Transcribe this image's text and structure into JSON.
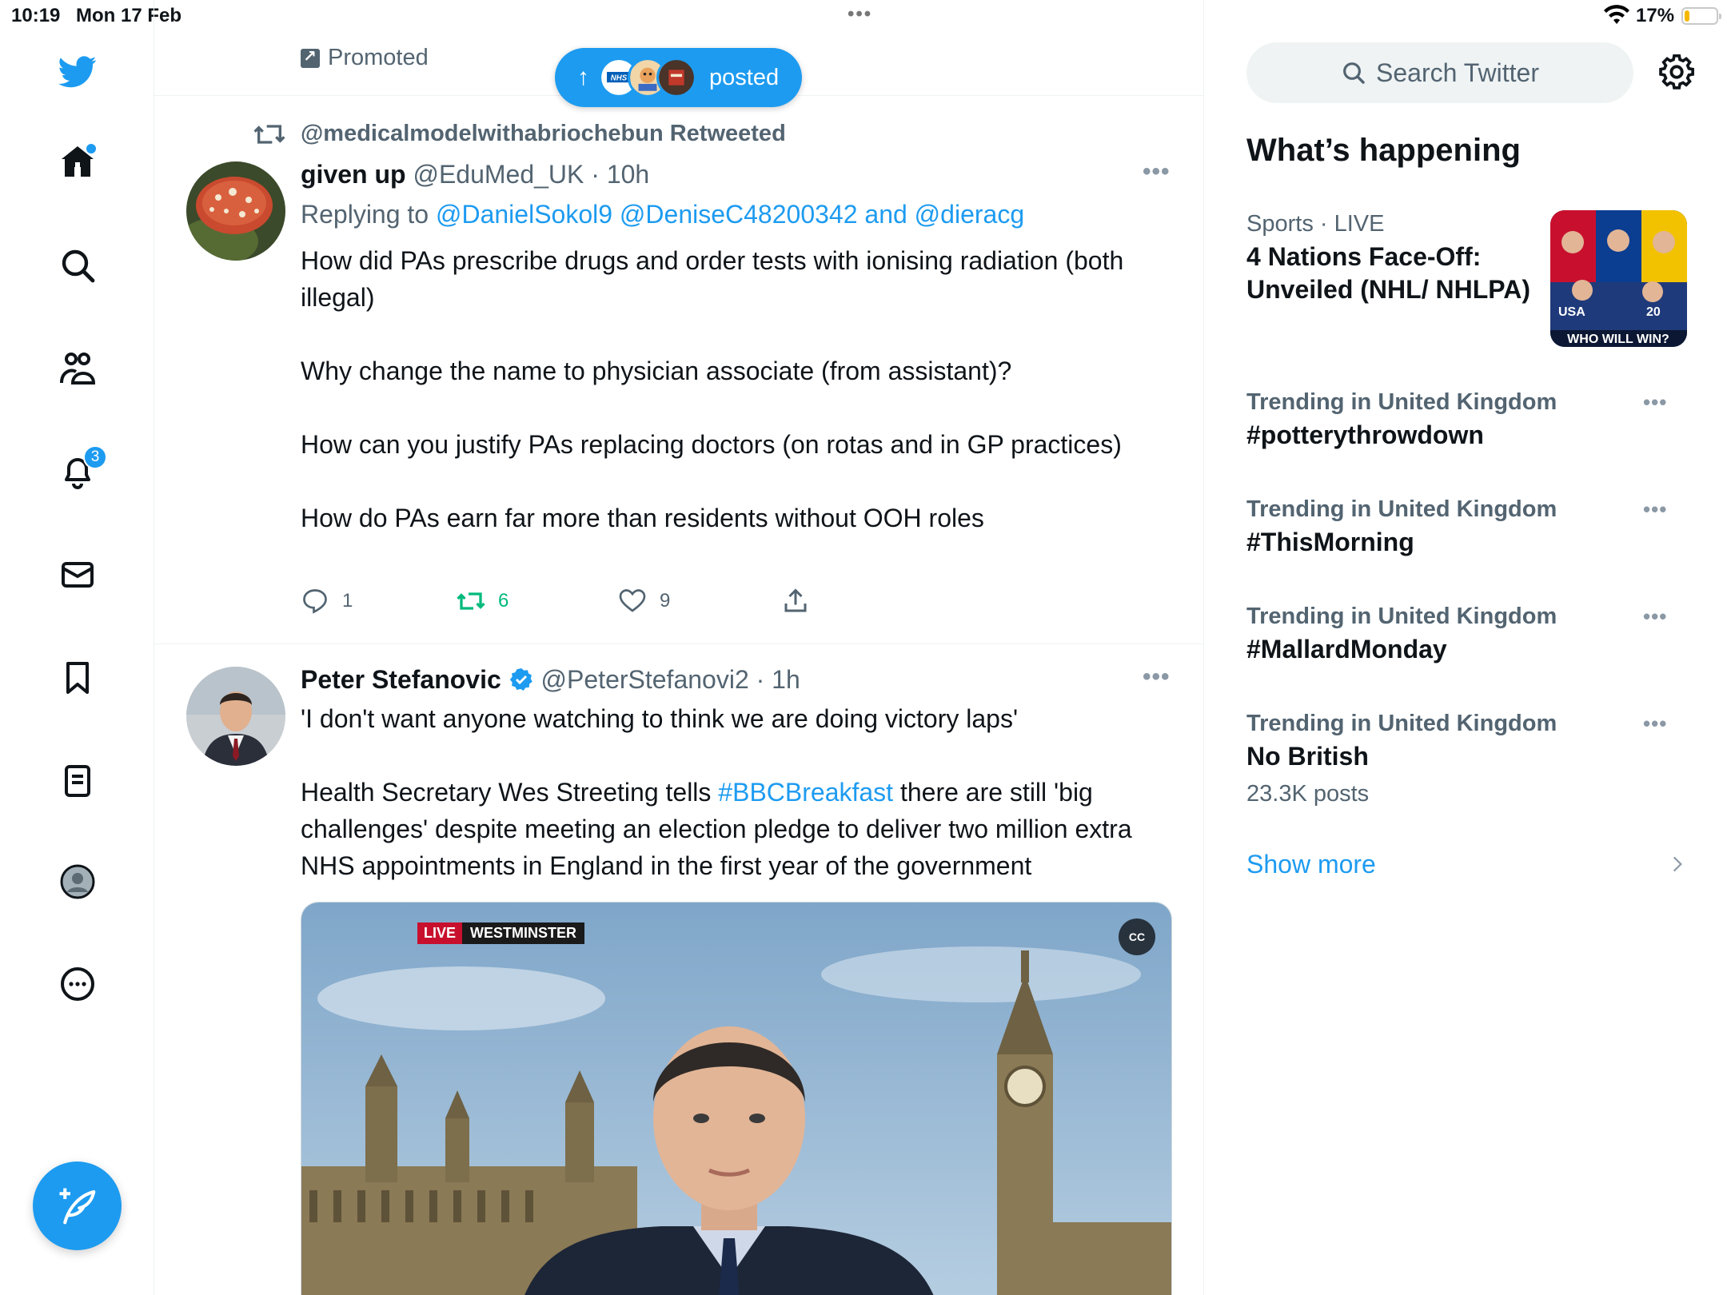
{
  "status": {
    "time": "10:19",
    "date": "Mon 17 Feb",
    "multitask": "•••",
    "battery_pct": "17%",
    "battery_level": 0.17
  },
  "nav": {
    "notifications_badge": "3"
  },
  "timeline": {
    "promoted_label": "Promoted",
    "new_posts_label": "posted"
  },
  "tweet1": {
    "retweeted_by": "@medicalmodelwithabriochebun Retweeted",
    "name": "given up",
    "handle": "@EduMed_UK",
    "sep": " · ",
    "time": "10h",
    "replying_to_prefix": "Replying to",
    "mention1": "@DanielSokol9",
    "mention2": "@DeniseC48200342",
    "and": "and",
    "mention3": "@dieracg",
    "para1": "How did PAs prescribe drugs and order tests with ionising radiation (both illegal)",
    "para2": "Why change the name to physician associate (from assistant)?",
    "para3": "How can you justify PAs replacing doctors (on rotas and in GP practices)",
    "para4": "How do PAs earn far more than residents without OOH roles",
    "replies": "1",
    "retweets": "6",
    "likes": "9"
  },
  "tweet2": {
    "name": "Peter Stefanovic",
    "handle": "@PeterStefanovi2",
    "sep": " · ",
    "time": "1h",
    "para1": "'I don't want anyone watching to think we are doing victory laps'",
    "para2_pre": "Health Secretary Wes Streeting tells ",
    "para2_tag": "#BBCBreakfast",
    "para2_post": " there are still 'big challenges' despite meeting an election pledge to deliver two million extra NHS appointments in England in the first year of the government",
    "media_live": "LIVE",
    "media_location": "WESTMINSTER",
    "media_cc": "CC"
  },
  "sidebar": {
    "search_placeholder": "Search Twitter",
    "whats_happening": "What’s happening",
    "trends": [
      {
        "category": "Sports",
        "live": " · LIVE",
        "title": "4 Nations Face-Off: Unveiled (NHL/ NHLPA)",
        "image_caption": "WHO WILL WIN?"
      },
      {
        "category": "Trending in United Kingdom",
        "title": "#potterythrowdown"
      },
      {
        "category": "Trending in United Kingdom",
        "title": "#ThisMorning"
      },
      {
        "category": "Trending in United Kingdom",
        "title": "#MallardMonday"
      },
      {
        "category": "Trending in United Kingdom",
        "title": "No British",
        "count": "23.3K posts"
      }
    ],
    "show_more": "Show more"
  }
}
